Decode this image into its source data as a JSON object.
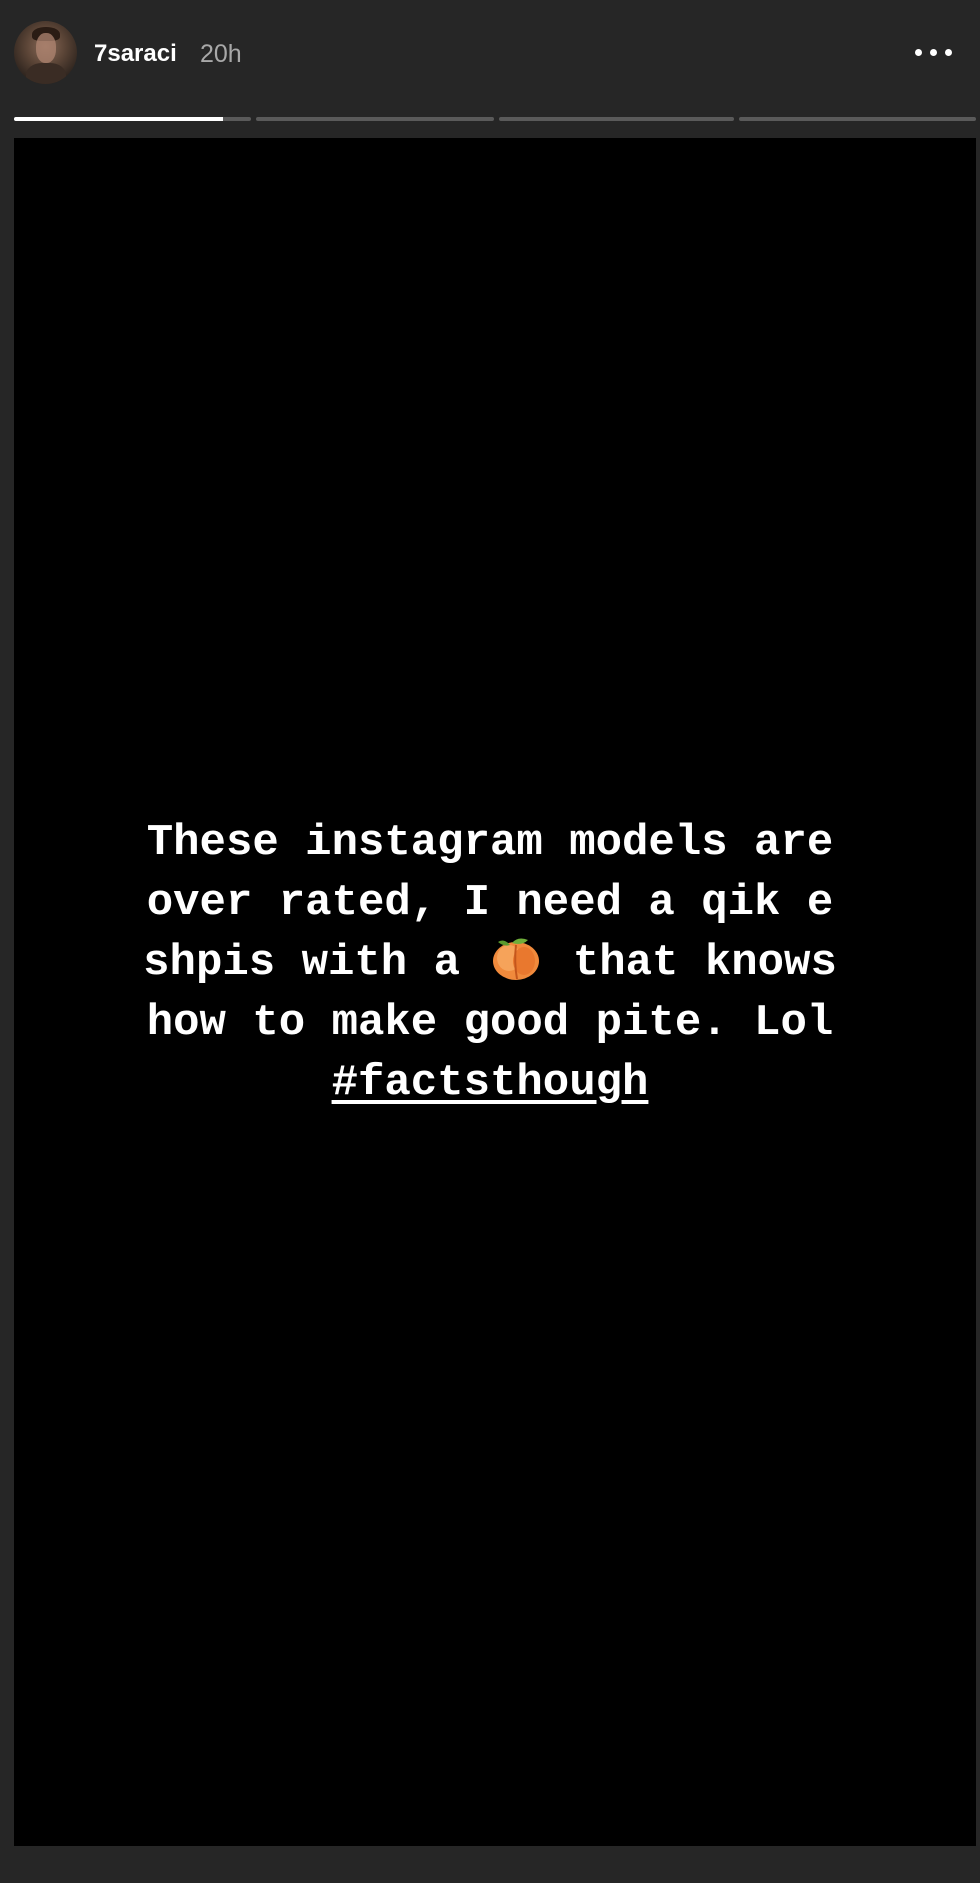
{
  "header": {
    "username": "7saraci",
    "time_ago": "20h",
    "more_icon": "more-horizontal-icon"
  },
  "progress": {
    "segment_count": 4,
    "segments": [
      {
        "fill": 0.88
      },
      {
        "fill": 0
      },
      {
        "fill": 0
      },
      {
        "fill": 0
      }
    ],
    "fill_color": "#ffffff",
    "track_color": "#5a5a5a"
  },
  "story": {
    "background_color": "#000000",
    "caption_lines": [
      "These instagram models are",
      "over rated, I need a qik e",
      "that knows",
      "how to make good pite. Lol"
    ],
    "line3_prefix": "shpis with a",
    "emoji": "peach-emoji",
    "hashtag": "#factsthough"
  }
}
